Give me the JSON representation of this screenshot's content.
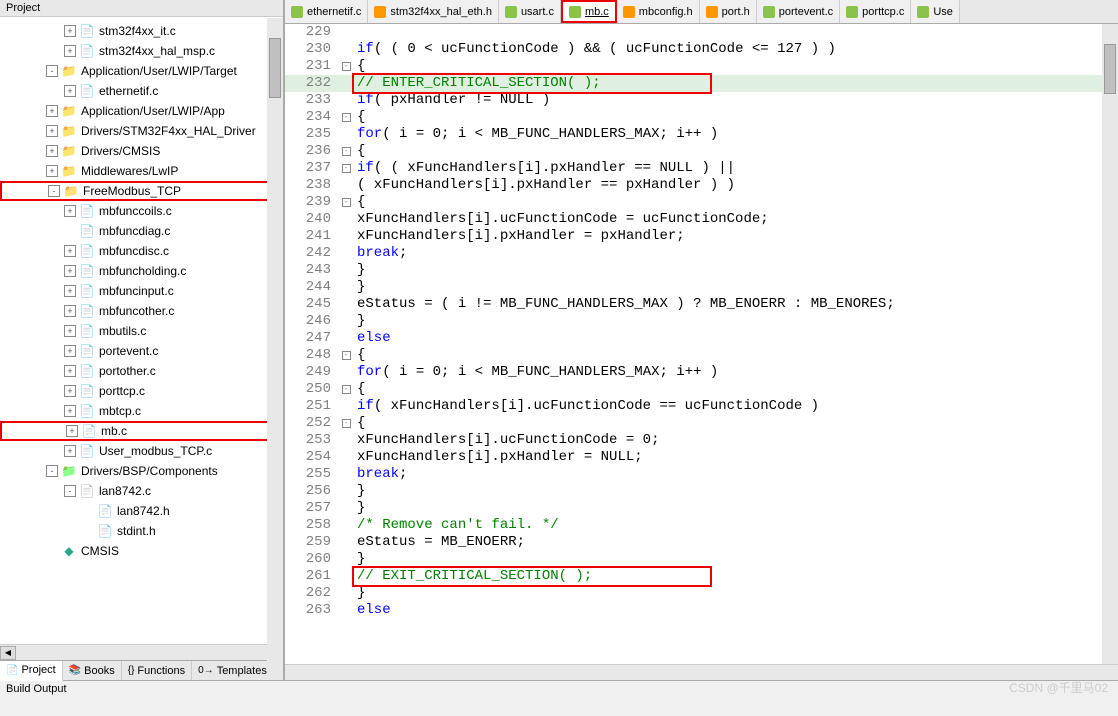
{
  "sidebar": {
    "title": "Project",
    "tree": [
      {
        "depth": 3,
        "toggle": "+",
        "icon": "file",
        "label": "stm32f4xx_it.c"
      },
      {
        "depth": 3,
        "toggle": "+",
        "icon": "file",
        "label": "stm32f4xx_hal_msp.c"
      },
      {
        "depth": 2,
        "toggle": "-",
        "icon": "folder",
        "label": "Application/User/LWIP/Target"
      },
      {
        "depth": 3,
        "toggle": "+",
        "icon": "file",
        "label": "ethernetif.c"
      },
      {
        "depth": 2,
        "toggle": "+",
        "icon": "folder",
        "label": "Application/User/LWIP/App"
      },
      {
        "depth": 2,
        "toggle": "+",
        "icon": "folder",
        "label": "Drivers/STM32F4xx_HAL_Driver"
      },
      {
        "depth": 2,
        "toggle": "+",
        "icon": "folder",
        "label": "Drivers/CMSIS"
      },
      {
        "depth": 2,
        "toggle": "+",
        "icon": "folder",
        "label": "Middlewares/LwIP"
      },
      {
        "depth": 2,
        "toggle": "-",
        "icon": "folder",
        "label": "FreeModbus_TCP",
        "redbox": true
      },
      {
        "depth": 3,
        "toggle": "+",
        "icon": "file",
        "label": "mbfunccoils.c"
      },
      {
        "depth": 3,
        "toggle": "",
        "icon": "file",
        "label": "mbfuncdiag.c"
      },
      {
        "depth": 3,
        "toggle": "+",
        "icon": "file",
        "label": "mbfuncdisc.c"
      },
      {
        "depth": 3,
        "toggle": "+",
        "icon": "file",
        "label": "mbfuncholding.c"
      },
      {
        "depth": 3,
        "toggle": "+",
        "icon": "file",
        "label": "mbfuncinput.c"
      },
      {
        "depth": 3,
        "toggle": "+",
        "icon": "file",
        "label": "mbfuncother.c"
      },
      {
        "depth": 3,
        "toggle": "+",
        "icon": "file",
        "label": "mbutils.c"
      },
      {
        "depth": 3,
        "toggle": "+",
        "icon": "file",
        "label": "portevent.c"
      },
      {
        "depth": 3,
        "toggle": "+",
        "icon": "file",
        "label": "portother.c"
      },
      {
        "depth": 3,
        "toggle": "+",
        "icon": "file",
        "label": "porttcp.c"
      },
      {
        "depth": 3,
        "toggle": "+",
        "icon": "file",
        "label": "mbtcp.c"
      },
      {
        "depth": 3,
        "toggle": "+",
        "icon": "file",
        "label": "mb.c",
        "redbox": true
      },
      {
        "depth": 3,
        "toggle": "+",
        "icon": "file",
        "label": "User_modbus_TCP.c"
      },
      {
        "depth": 2,
        "toggle": "-",
        "icon": "folder-g",
        "label": "Drivers/BSP/Components"
      },
      {
        "depth": 3,
        "toggle": "-",
        "icon": "file-g",
        "label": "lan8742.c"
      },
      {
        "depth": 4,
        "toggle": "",
        "icon": "file-h",
        "label": "lan8742.h"
      },
      {
        "depth": 4,
        "toggle": "",
        "icon": "file-h",
        "label": "stdint.h"
      },
      {
        "depth": 2,
        "toggle": "",
        "icon": "cmsis",
        "label": "CMSIS"
      }
    ],
    "tabs": [
      {
        "icon": "📄",
        "label": "Project",
        "active": true
      },
      {
        "icon": "📚",
        "label": "Books"
      },
      {
        "icon": "{}",
        "label": "Functions"
      },
      {
        "icon": "0→",
        "label": "Templates"
      }
    ]
  },
  "editor_tabs": [
    {
      "type": "c",
      "label": "ethernetif.c"
    },
    {
      "type": "h",
      "label": "stm32f4xx_hal_eth.h"
    },
    {
      "type": "c",
      "label": "usart.c"
    },
    {
      "type": "c",
      "label": "mb.c",
      "active": true,
      "redbox": true,
      "underline": true
    },
    {
      "type": "h",
      "label": "mbconfig.h"
    },
    {
      "type": "h",
      "label": "port.h"
    },
    {
      "type": "c",
      "label": "portevent.c"
    },
    {
      "type": "c",
      "label": "porttcp.c"
    },
    {
      "type": "c",
      "label": "Use"
    }
  ],
  "code_lines": [
    {
      "n": 229,
      "fold": "",
      "text": ""
    },
    {
      "n": 230,
      "fold": "",
      "text": "        if( ( 0 < ucFunctionCode ) && ( ucFunctionCode <= 127 ) )"
    },
    {
      "n": 231,
      "fold": "-",
      "text": "        {"
    },
    {
      "n": 232,
      "fold": "",
      "text": "//            ENTER_CRITICAL_SECTION(  );",
      "hl": true,
      "redbox": true,
      "comment": true
    },
    {
      "n": 233,
      "fold": "",
      "text": "            if( pxHandler != NULL )"
    },
    {
      "n": 234,
      "fold": "-",
      "text": "            {"
    },
    {
      "n": 235,
      "fold": "",
      "text": "                for( i = 0; i < MB_FUNC_HANDLERS_MAX; i++ )"
    },
    {
      "n": 236,
      "fold": "-",
      "text": "                {"
    },
    {
      "n": 237,
      "fold": "-",
      "text": "                    if( ( xFuncHandlers[i].pxHandler == NULL ) ||"
    },
    {
      "n": 238,
      "fold": "",
      "text": "                        ( xFuncHandlers[i].pxHandler == pxHandler ) )"
    },
    {
      "n": 239,
      "fold": "-",
      "text": "                    {"
    },
    {
      "n": 240,
      "fold": "",
      "text": "                        xFuncHandlers[i].ucFunctionCode = ucFunctionCode;"
    },
    {
      "n": 241,
      "fold": "",
      "text": "                        xFuncHandlers[i].pxHandler = pxHandler;"
    },
    {
      "n": 242,
      "fold": "",
      "text": "                        break;"
    },
    {
      "n": 243,
      "fold": "",
      "text": "                    }"
    },
    {
      "n": 244,
      "fold": "",
      "text": "                }"
    },
    {
      "n": 245,
      "fold": "",
      "text": "                eStatus = ( i != MB_FUNC_HANDLERS_MAX ) ? MB_ENOERR : MB_ENORES;"
    },
    {
      "n": 246,
      "fold": "",
      "text": "            }"
    },
    {
      "n": 247,
      "fold": "",
      "text": "            else"
    },
    {
      "n": 248,
      "fold": "-",
      "text": "            {"
    },
    {
      "n": 249,
      "fold": "",
      "text": "                for( i = 0; i < MB_FUNC_HANDLERS_MAX; i++ )"
    },
    {
      "n": 250,
      "fold": "-",
      "text": "                {"
    },
    {
      "n": 251,
      "fold": "",
      "text": "                    if( xFuncHandlers[i].ucFunctionCode == ucFunctionCode )"
    },
    {
      "n": 252,
      "fold": "-",
      "text": "                    {"
    },
    {
      "n": 253,
      "fold": "",
      "text": "                        xFuncHandlers[i].ucFunctionCode = 0;"
    },
    {
      "n": 254,
      "fold": "",
      "text": "                        xFuncHandlers[i].pxHandler = NULL;"
    },
    {
      "n": 255,
      "fold": "",
      "text": "                        break;"
    },
    {
      "n": 256,
      "fold": "",
      "text": "                    }"
    },
    {
      "n": 257,
      "fold": "",
      "text": "                }"
    },
    {
      "n": 258,
      "fold": "",
      "text": "                /* Remove can't fail. */",
      "comment": true
    },
    {
      "n": 259,
      "fold": "",
      "text": "                eStatus = MB_ENOERR;"
    },
    {
      "n": 260,
      "fold": "",
      "text": "            }"
    },
    {
      "n": 261,
      "fold": "",
      "text": "//            EXIT_CRITICAL_SECTION(  );",
      "redbox": true,
      "comment": true
    },
    {
      "n": 262,
      "fold": "",
      "text": "        }"
    },
    {
      "n": 263,
      "fold": "",
      "text": "        else"
    }
  ],
  "build_output": "Build Output",
  "watermark": "CSDN @千里马02"
}
